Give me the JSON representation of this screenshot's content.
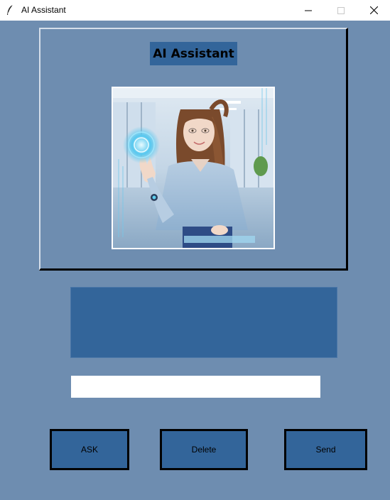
{
  "window": {
    "title": "AI Assistant",
    "icon": "feather-icon",
    "controls": [
      "minimize-icon",
      "maximize-icon",
      "close-icon"
    ]
  },
  "main": {
    "heading": "AI Assistant",
    "output_text": "",
    "input": {
      "value": "",
      "placeholder": ""
    }
  },
  "buttons": {
    "ask": "ASK",
    "delete": "Delete",
    "send": "Send"
  },
  "colors": {
    "background": "#6e8db0",
    "panel": "#33659a",
    "entry": "#ffffff"
  }
}
